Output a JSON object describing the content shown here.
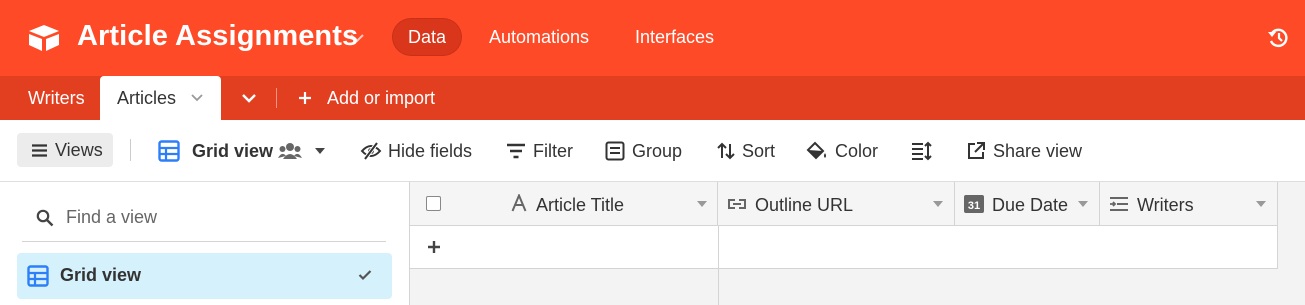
{
  "base": {
    "title": "Article Assignments",
    "brand_color": "#ff4a27"
  },
  "topnav": {
    "items": [
      {
        "label": "Data",
        "active": true
      },
      {
        "label": "Automations",
        "active": false
      },
      {
        "label": "Interfaces",
        "active": false
      }
    ],
    "history_icon": "history-icon"
  },
  "tables": {
    "tabs": [
      {
        "label": "Writers",
        "active": false
      },
      {
        "label": "Articles",
        "active": true
      }
    ],
    "add_label": "Add or import"
  },
  "toolbar": {
    "views_label": "Views",
    "current_view": "Grid view",
    "hide_fields": "Hide fields",
    "filter": "Filter",
    "group": "Group",
    "sort": "Sort",
    "color": "Color",
    "share": "Share view"
  },
  "sidebar": {
    "search_placeholder": "Find a view",
    "views": [
      {
        "label": "Grid view",
        "selected": true
      }
    ]
  },
  "grid": {
    "columns": [
      {
        "label": "Article Title",
        "icon": "text-field-icon"
      },
      {
        "label": "Outline URL",
        "icon": "link-field-icon"
      },
      {
        "label": "Due Date",
        "icon": "calendar-field-icon"
      },
      {
        "label": "Writers",
        "icon": "linked-record-field-icon"
      }
    ],
    "add_row_symbol": "+"
  }
}
